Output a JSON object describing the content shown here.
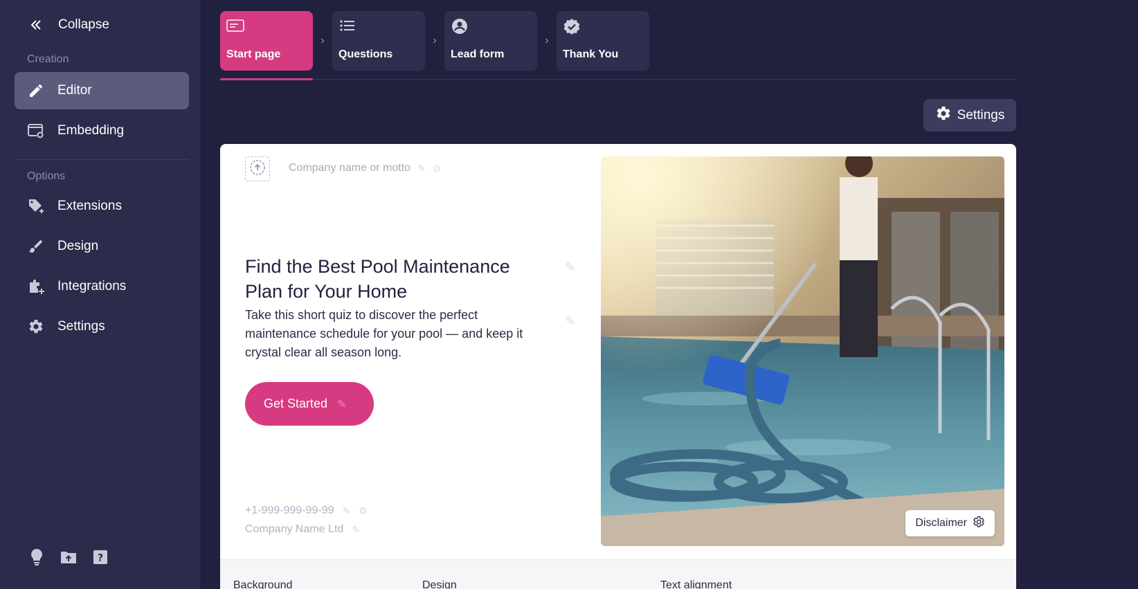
{
  "sidebar": {
    "collapse_label": "Collapse",
    "creation_label": "Creation",
    "options_label": "Options",
    "creation_items": [
      {
        "label": "Editor",
        "icon": "pencil-icon",
        "active": true
      },
      {
        "label": "Embedding",
        "icon": "embed-gear-icon",
        "active": false
      }
    ],
    "option_items": [
      {
        "label": "Extensions",
        "icon": "tag-plus-icon"
      },
      {
        "label": "Design",
        "icon": "brush-icon"
      },
      {
        "label": "Integrations",
        "icon": "puzzle-plus-icon"
      },
      {
        "label": "Settings",
        "icon": "gear-icon"
      }
    ],
    "bottom_icons": [
      "lightbulb-icon",
      "folder-upload-icon",
      "help-icon"
    ]
  },
  "steps": [
    {
      "label": "Start page",
      "icon": "page-icon",
      "active": true
    },
    {
      "label": "Questions",
      "icon": "list-icon",
      "active": false
    },
    {
      "label": "Lead form",
      "icon": "user-circle-icon",
      "active": false
    },
    {
      "label": "Thank You",
      "icon": "verified-badge-icon",
      "active": false
    }
  ],
  "toolbar": {
    "settings_label": "Settings"
  },
  "card": {
    "motto_placeholder": "Company name or motto",
    "headline": "Find the Best Pool Maintenance Plan for Your Home",
    "subtext": "Take this short quiz to discover the perfect maintenance schedule for your pool — and keep it crystal clear all season long.",
    "cta_label": "Get Started",
    "phone": "+1-999-999-99-99",
    "company_name": "Company Name Ltd",
    "disclaimer_label": "Disclaimer"
  },
  "bottom_bar": {
    "background_label": "Background",
    "design_label": "Design",
    "alignment_label": "Text alignment"
  },
  "colors": {
    "accent": "#d63a80",
    "page_bg": "#21213f",
    "sidebar_bg": "#2b2b4b"
  }
}
